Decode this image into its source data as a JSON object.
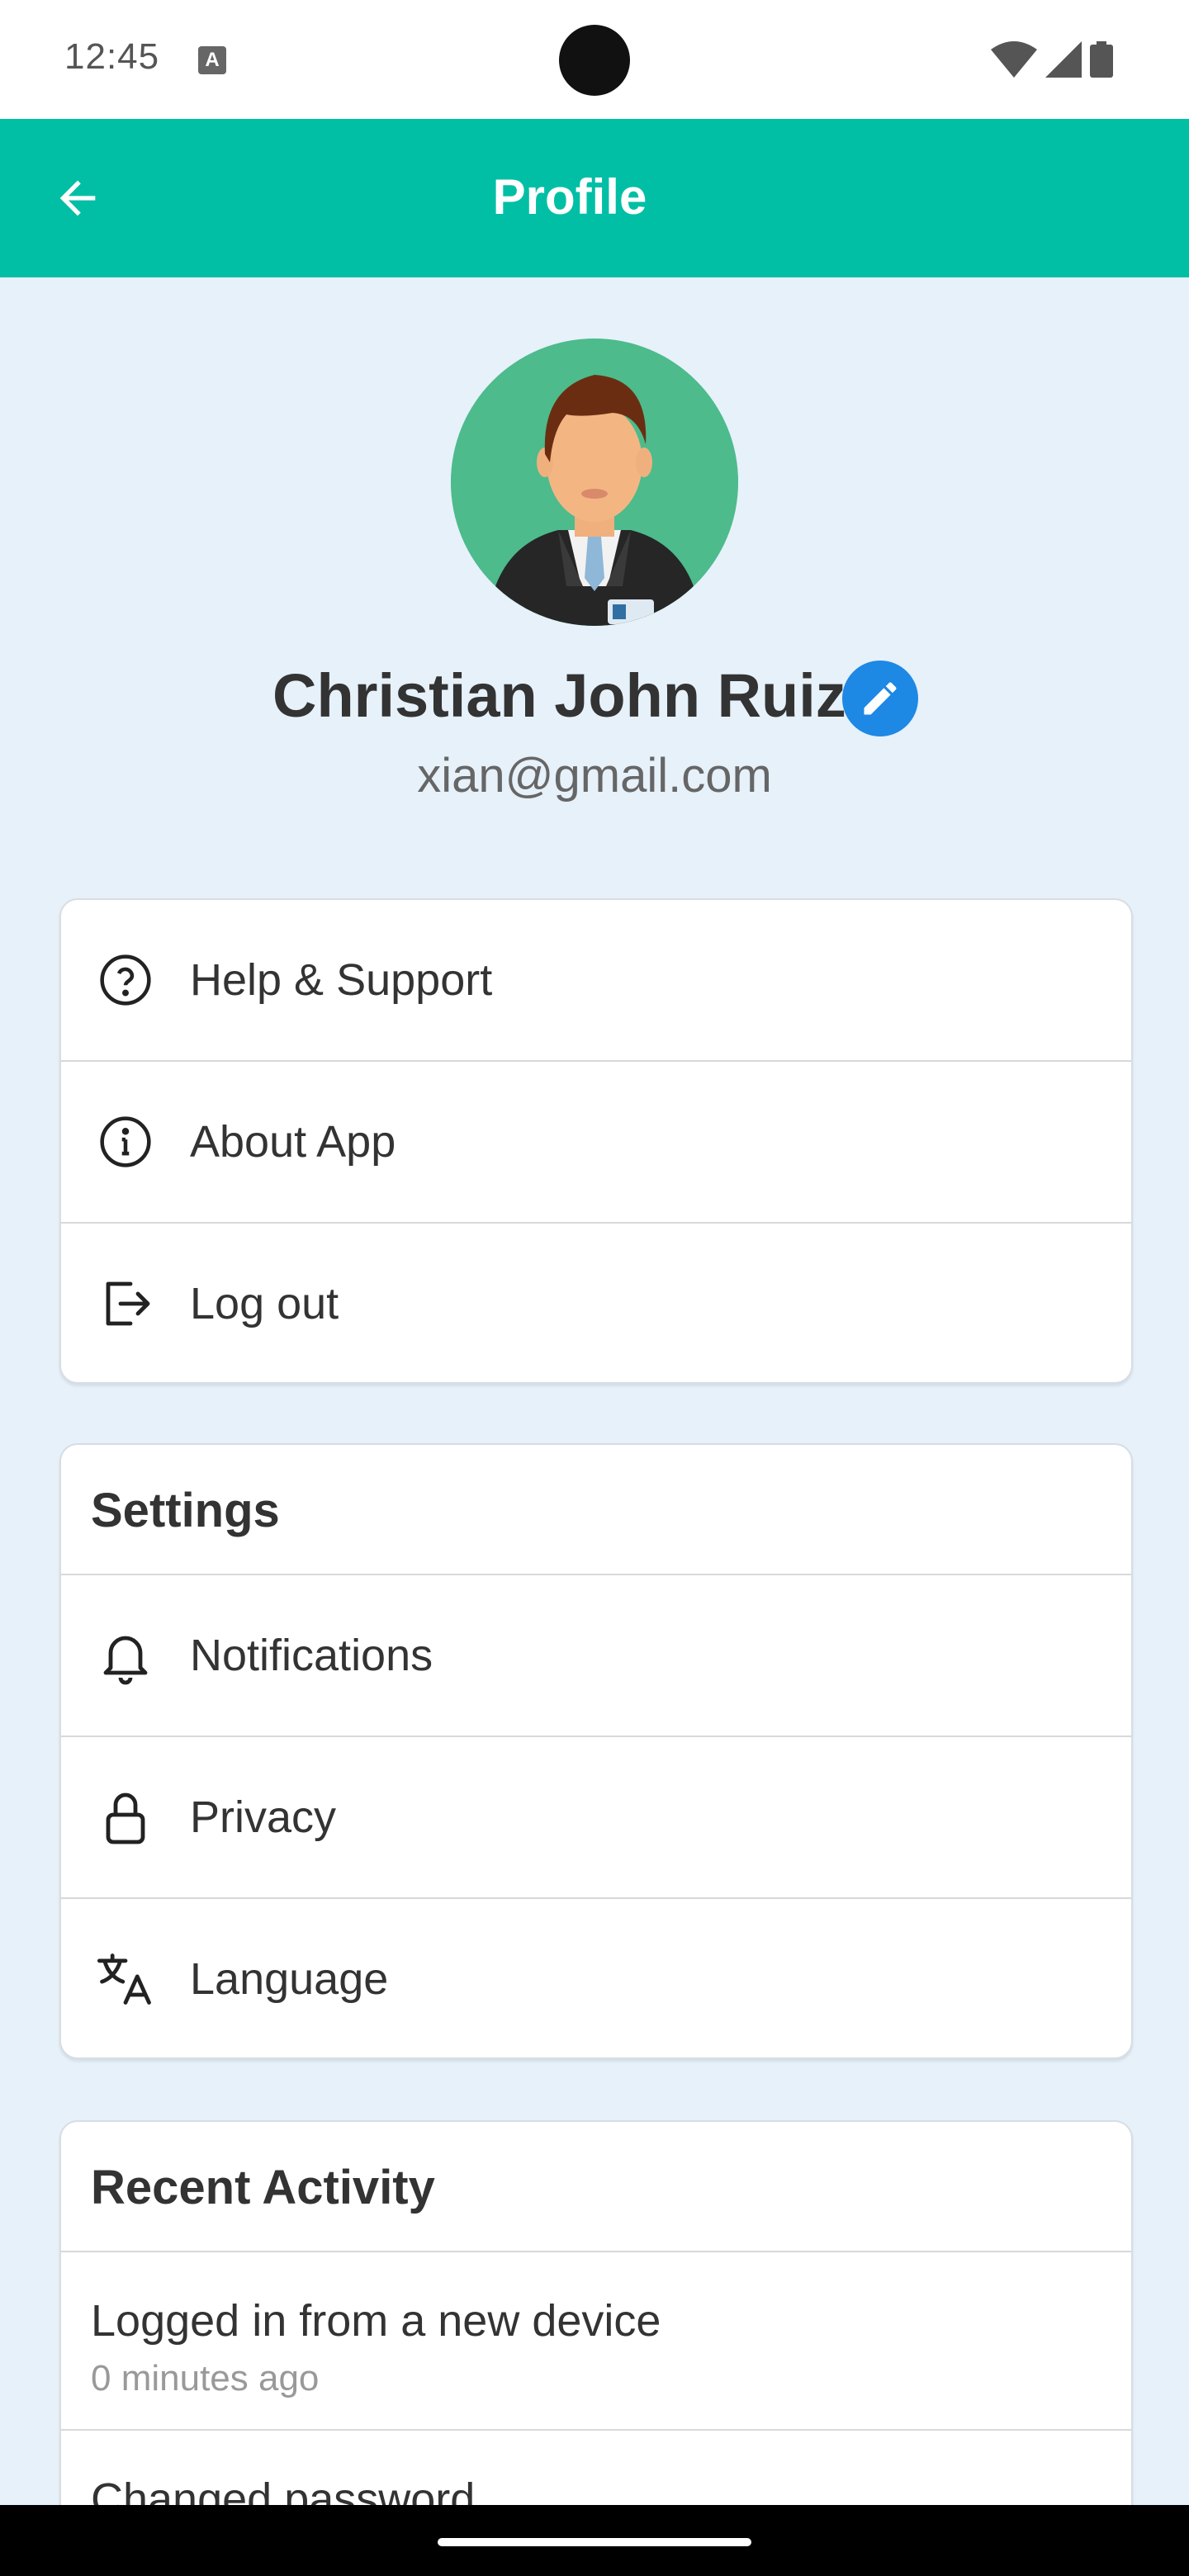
{
  "status_bar": {
    "time": "12:45",
    "notification_icon": "font-a-icon",
    "icons": [
      "wifi-icon",
      "signal-icon",
      "battery-icon"
    ]
  },
  "app_bar": {
    "title": "Profile",
    "back_icon": "arrow-left-icon",
    "color": "#00bfa5"
  },
  "profile": {
    "name": "Christian John Ruiz",
    "email": "xian@gmail.com",
    "edit_icon": "pencil-icon",
    "edit_color": "#1e88e5",
    "avatar_icon": "businessman-avatar"
  },
  "menu": {
    "items": [
      {
        "label": "Help & Support",
        "icon": "help-circle-icon"
      },
      {
        "label": "About App",
        "icon": "info-circle-icon"
      },
      {
        "label": "Log out",
        "icon": "logout-icon"
      }
    ]
  },
  "settings": {
    "title": "Settings",
    "items": [
      {
        "label": "Notifications",
        "icon": "bell-icon"
      },
      {
        "label": "Privacy",
        "icon": "lock-icon"
      },
      {
        "label": "Language",
        "icon": "translate-icon"
      }
    ]
  },
  "recent_activity": {
    "title": "Recent Activity",
    "items": [
      {
        "title": "Logged in from a new device",
        "time": "0 minutes ago"
      },
      {
        "title": "Changed password",
        "time": ""
      }
    ]
  }
}
